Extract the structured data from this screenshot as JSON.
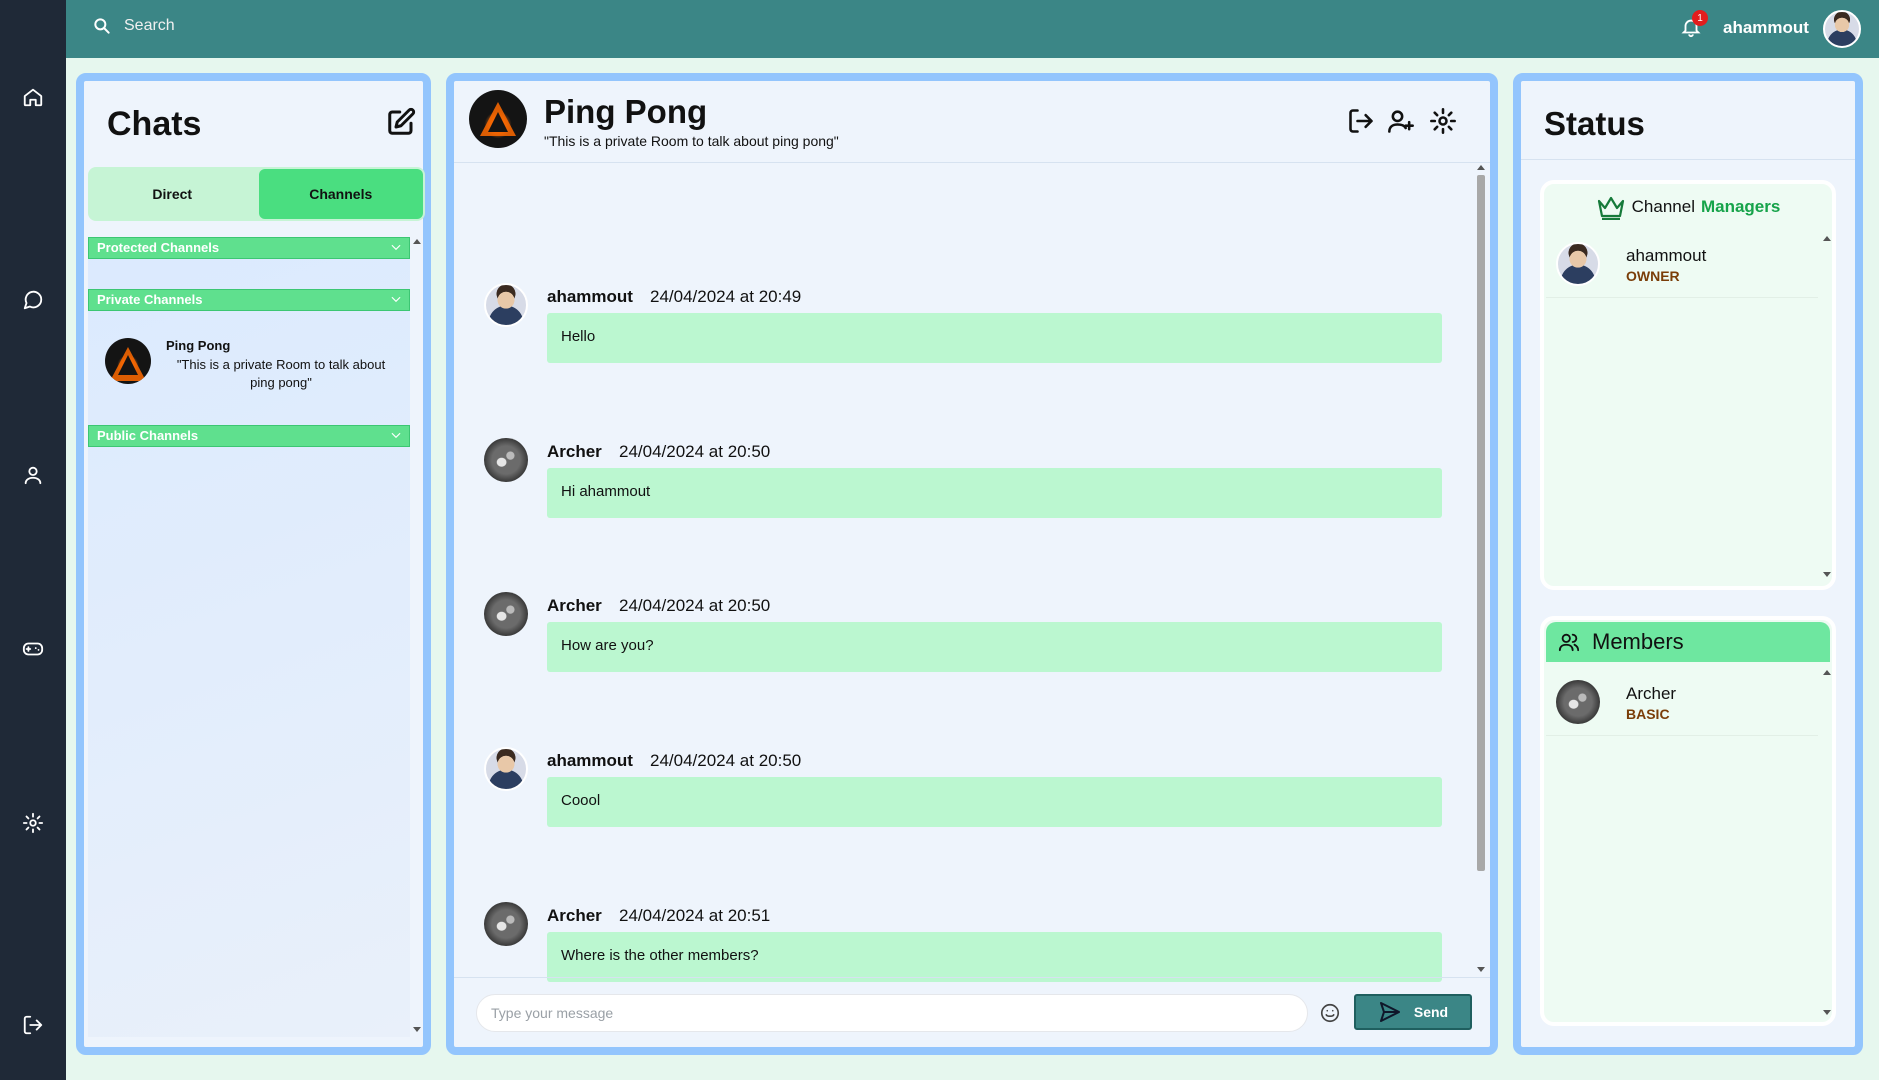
{
  "topbar": {
    "search_placeholder": "Search",
    "notification_count": "1",
    "username": "ahammout"
  },
  "sidebar": {
    "icons": [
      "home-icon",
      "chat-icon",
      "profile-icon",
      "game-icon",
      "settings-icon",
      "logout-icon"
    ]
  },
  "chats": {
    "title": "Chats",
    "tabs": [
      {
        "label": "Direct",
        "active": false
      },
      {
        "label": "Channels",
        "active": true
      }
    ],
    "groups": {
      "protected": "Protected Channels",
      "private": "Private Channels",
      "public": "Public Channels"
    },
    "private_items": [
      {
        "name": "Ping Pong",
        "description": "\"This is a private Room to talk about ping pong\""
      }
    ]
  },
  "room": {
    "title": "Ping Pong",
    "subtitle": "\"This is a private Room to talk about ping pong\"",
    "messages": [
      {
        "author": "ahammout",
        "time": "24/04/2024 at 20:49",
        "text": "Hello"
      },
      {
        "author": "Archer",
        "time": "24/04/2024 at 20:50",
        "text": "Hi ahammout"
      },
      {
        "author": "Archer",
        "time": "24/04/2024 at 20:50",
        "text": "How are you?"
      },
      {
        "author": "ahammout",
        "time": "24/04/2024 at 20:50",
        "text": "Coool"
      },
      {
        "author": "Archer",
        "time": "24/04/2024 at 20:51",
        "text": "Where is the other members?"
      }
    ],
    "input_placeholder": "Type your message",
    "send_label": "Send"
  },
  "status": {
    "title": "Status",
    "managers_prefix": "Channel",
    "managers_accent": "Managers",
    "managers": [
      {
        "name": "ahammout",
        "role": "OWNER"
      }
    ],
    "members_title": "Members",
    "members": [
      {
        "name": "Archer",
        "role": "BASIC"
      }
    ]
  },
  "colors": {
    "topbar": "#3b8686",
    "rail": "#1f2937",
    "accent_green": "#4ade80",
    "bubble": "#bbf7d0",
    "panel_border": "#93c5fd"
  }
}
